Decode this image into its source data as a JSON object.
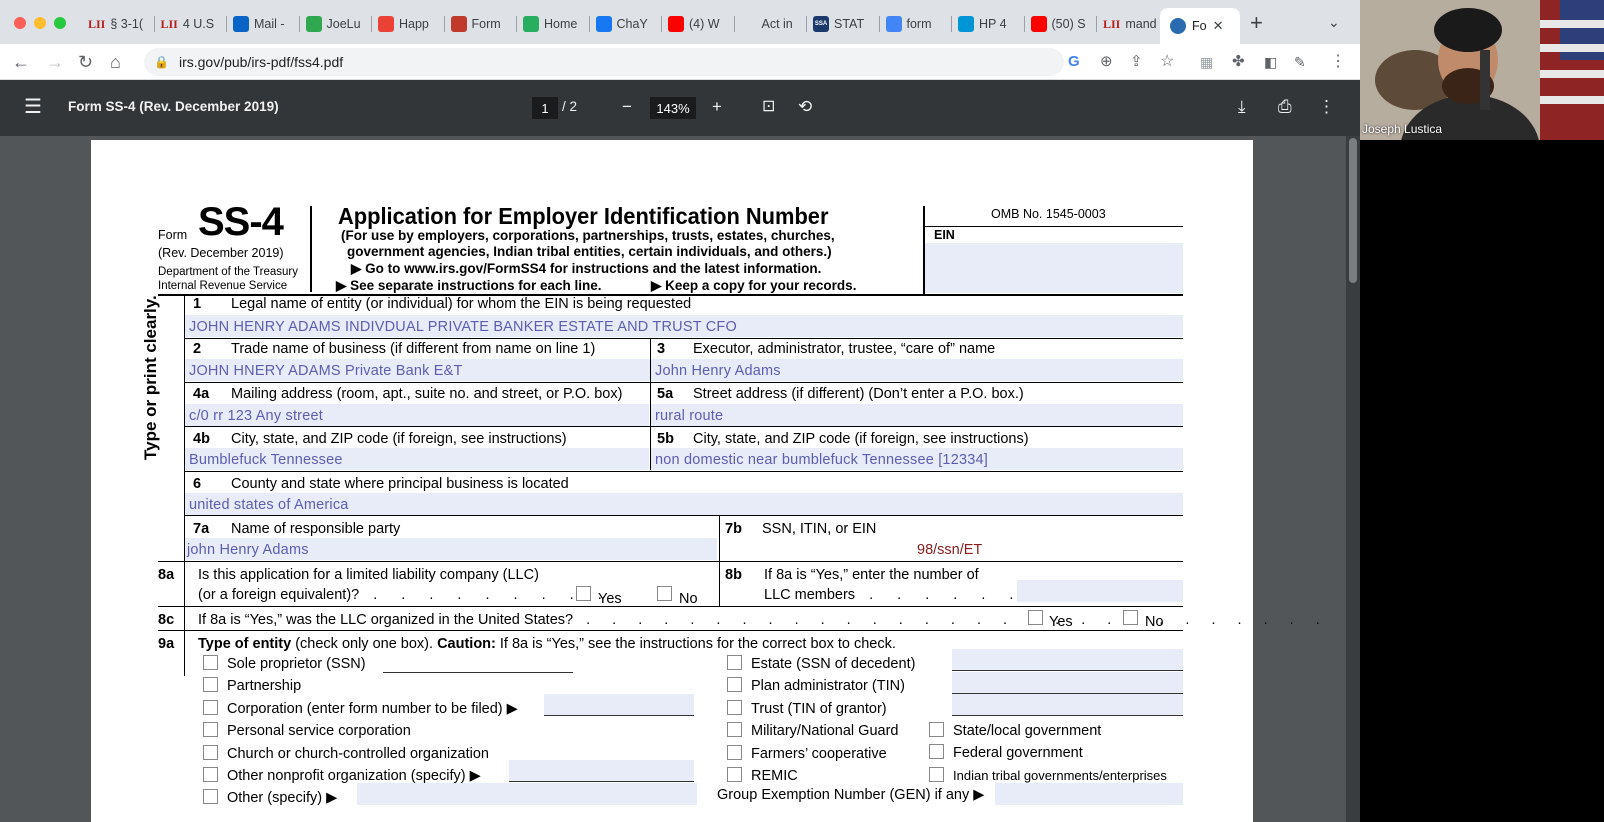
{
  "browser": {
    "tabs": [
      {
        "icon": "LII",
        "label": "§ 3-1("
      },
      {
        "icon": "LII",
        "label": "4 U.S"
      },
      {
        "icon": "outlook-icon",
        "label": "Mail -"
      },
      {
        "icon": "play-icon",
        "label": "JoeLu"
      },
      {
        "icon": "gmail-icon",
        "label": "Happ"
      },
      {
        "icon": "apple-icon",
        "label": "Form"
      },
      {
        "icon": "g-icon",
        "label": "Home"
      },
      {
        "icon": "facebook-icon",
        "label": "ChaY"
      },
      {
        "icon": "youtube-icon",
        "label": "(4) W"
      },
      {
        "icon": "blank-icon",
        "label": "Act in"
      },
      {
        "icon": "SSA",
        "label": "STAT"
      },
      {
        "icon": "google-icon",
        "label": "form"
      },
      {
        "icon": "hp-icon",
        "label": "HP 4"
      },
      {
        "icon": "youtube-icon",
        "label": "(50) S"
      },
      {
        "icon": "LII",
        "label": "mand"
      }
    ],
    "active_tab": "Fo",
    "url": "irs.gov/pub/irs-pdf/fss4.pdf"
  },
  "pdf_toolbar": {
    "title": "Form SS-4 (Rev. December 2019)",
    "page_current": "1",
    "page_total": "/  2",
    "zoom": "143%"
  },
  "camera": {
    "name": "Joseph Lustica"
  },
  "form": {
    "form_word": "Form",
    "form_id": "SS-4",
    "rev": "(Rev. December 2019)",
    "dept1": "Department of the Treasury",
    "dept2": "Internal Revenue Service",
    "title": "Application for Employer Identification Number",
    "sub1": "(For use by employers, corporations, partnerships, trusts, estates, churches,",
    "sub2": "government agencies, Indian tribal entities, certain individuals, and others.)",
    "goto": "▶ Go to www.irs.gov/FormSS4 for instructions and the latest information.",
    "see": "▶ See separate instructions for each line.",
    "keep": "▶ Keep a copy for your records.",
    "omb": "OMB No. 1545-0003",
    "ein": "EIN",
    "side": "Type or print clearly.",
    "line1_num": "1",
    "line1_label": "Legal name of entity (or individual) for whom the EIN is being requested",
    "line1_val": "JOHN HENRY ADAMS INDIVDUAL PRIVATE BANKER ESTATE AND TRUST CFO",
    "line2_num": "2",
    "line2_label": "Trade name of business (if different from name on line 1)",
    "line2_val": "JOHN HNERY ADAMS Private Bank E&T",
    "line3_num": "3",
    "line3_label": "Executor, administrator, trustee, “care of” name",
    "line3_val": "John Henry Adams",
    "line4a_num": "4a",
    "line4a_label": "Mailing address (room, apt., suite no. and street, or P.O. box)",
    "line4a_val": "c/0 rr 123 Any street",
    "line5a_num": "5a",
    "line5a_label": "Street address (if different) (Don’t enter a P.O. box.)",
    "line5a_val": "rural route",
    "line4b_num": "4b",
    "line4b_label": "City, state, and ZIP code (if foreign, see instructions)",
    "line4b_val": "Bumblefuck Tennessee",
    "line5b_num": "5b",
    "line5b_label": "City, state, and ZIP code (if foreign, see instructions)",
    "line5b_val": "non domestic near bumblefuck Tennessee [12334]",
    "line6_num": "6",
    "line6_label": "County and state where principal business is located",
    "line6_val": "united states of America",
    "line7a_num": "7a",
    "line7a_label": "Name of responsible party",
    "line7a_val": "john Henry Adams",
    "line7b_num": "7b",
    "line7b_label": "SSN, ITIN, or EIN",
    "line7b_val": "98/ssn/ET",
    "line8a_num": "8a",
    "line8a_label": "Is this application for a limited liability company (LLC)",
    "line8a_label2": "(or a foreign equivalent)?",
    "yes": "Yes",
    "no": "No",
    "line8b_num": "8b",
    "line8b_label": "If 8a is “Yes,” enter the number of",
    "line8b_label2": "LLC members",
    "line8c_num": "8c",
    "line8c_label": "If 8a is “Yes,” was the LLC organized in the United States?",
    "line9a_num": "9a",
    "line9a_bold": "Type of entity",
    "line9a_mid": " (check only one box). ",
    "line9a_caution": "Caution:",
    "line9a_rest": " If 8a is “Yes,” see the instructions for the correct box to check.",
    "entities_left": [
      "Sole proprietor (SSN)",
      "Partnership",
      "Corporation (enter form number to be filed)  ▶",
      "Personal service corporation",
      "Church or church-controlled organization",
      "Other nonprofit organization (specify)  ▶",
      "Other (specify)  ▶"
    ],
    "entities_mid": [
      "Estate (SSN of decedent)",
      "Plan administrator (TIN)",
      "Trust (TIN of grantor)",
      "Military/National Guard",
      "Farmers’ cooperative",
      "REMIC"
    ],
    "entities_right": [
      "State/local government",
      "Federal government",
      "Indian tribal governments/enterprises"
    ],
    "gen": "Group Exemption Number (GEN) if any  ▶"
  }
}
